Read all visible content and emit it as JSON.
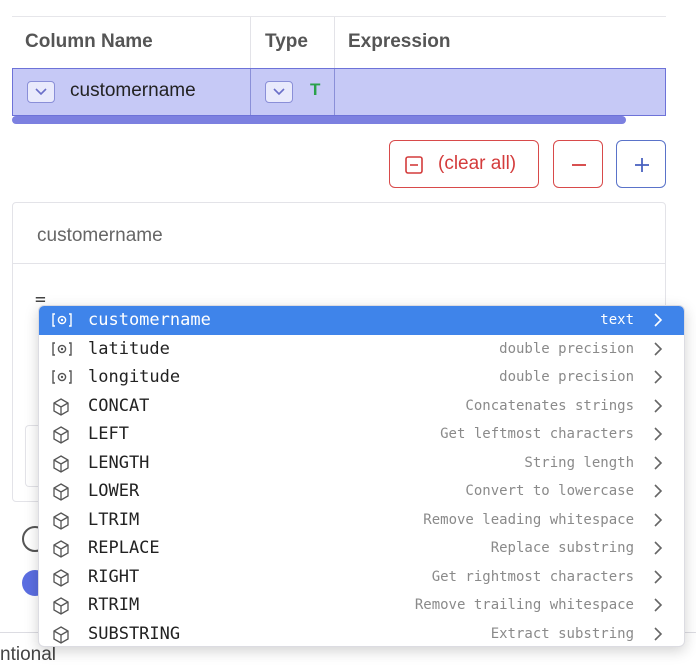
{
  "table": {
    "headers": {
      "column_name": "Column Name",
      "type": "Type",
      "expression": "Expression"
    },
    "row": {
      "column_name": "customername",
      "type_badge": "T",
      "expression": ""
    }
  },
  "actions": {
    "clear_all": "(clear all)"
  },
  "panel": {
    "title": "customername",
    "editor_text": "=",
    "bottom_label": "ntional"
  },
  "colors": {
    "accent": "#6d72d8",
    "row_bg": "#c6c9f6",
    "danger": "#d43c3c",
    "primary": "#4a63c0",
    "selected": "#3f84ea",
    "type_badge": "#2aa14b"
  },
  "autocomplete": {
    "items": [
      {
        "kind": "column",
        "icon": "column-icon",
        "name": "customername",
        "desc": "text",
        "selected": true
      },
      {
        "kind": "column",
        "icon": "column-icon",
        "name": "latitude",
        "desc": "double precision"
      },
      {
        "kind": "column",
        "icon": "column-icon",
        "name": "longitude",
        "desc": "double precision"
      },
      {
        "kind": "function",
        "icon": "cube-icon",
        "name": "CONCAT",
        "desc": "Concatenates strings"
      },
      {
        "kind": "function",
        "icon": "cube-icon",
        "name": "LEFT",
        "desc": "Get leftmost characters"
      },
      {
        "kind": "function",
        "icon": "cube-icon",
        "name": "LENGTH",
        "desc": "String length"
      },
      {
        "kind": "function",
        "icon": "cube-icon",
        "name": "LOWER",
        "desc": "Convert to lowercase"
      },
      {
        "kind": "function",
        "icon": "cube-icon",
        "name": "LTRIM",
        "desc": "Remove leading whitespace"
      },
      {
        "kind": "function",
        "icon": "cube-icon",
        "name": "REPLACE",
        "desc": "Replace substring"
      },
      {
        "kind": "function",
        "icon": "cube-icon",
        "name": "RIGHT",
        "desc": "Get rightmost characters"
      },
      {
        "kind": "function",
        "icon": "cube-icon",
        "name": "RTRIM",
        "desc": "Remove trailing whitespace"
      },
      {
        "kind": "function",
        "icon": "cube-icon",
        "name": "SUBSTRING",
        "desc": "Extract substring"
      }
    ]
  }
}
